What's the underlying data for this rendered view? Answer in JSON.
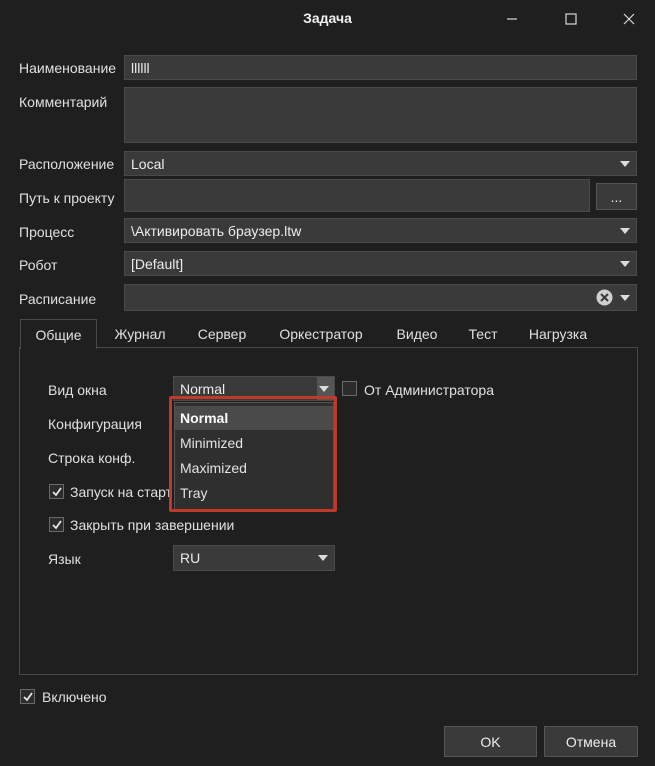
{
  "window": {
    "title": "Задача"
  },
  "form": {
    "name_label": "Наименование",
    "name_value": "llllll",
    "comment_label": "Комментарий",
    "comment_value": "",
    "location_label": "Расположение",
    "location_value": "Local",
    "project_path_label": "Путь к проекту",
    "project_path_value": "",
    "browse_label": "...",
    "process_label": "Процесс",
    "process_value": "\\Активировать браузер.ltw",
    "robot_label": "Робот",
    "robot_value": "[Default]",
    "schedule_label": "Расписание",
    "schedule_value": ""
  },
  "tabs": [
    {
      "label": "Общие",
      "active": true
    },
    {
      "label": "Журнал"
    },
    {
      "label": "Сервер"
    },
    {
      "label": "Оркестратор"
    },
    {
      "label": "Видео"
    },
    {
      "label": "Тест"
    },
    {
      "label": "Нагрузка"
    }
  ],
  "general": {
    "window_mode_label": "Вид окна",
    "window_mode_value": "Normal",
    "admin_label": "От Администратора",
    "admin_checked": false,
    "config_label": "Конфигурация",
    "config_string_label": "Строка конф.",
    "autostart_label": "Запуск на старте",
    "autostart_checked": true,
    "close_on_finish_label": "Закрыть при завершении",
    "close_on_finish_checked": true,
    "language_label": "Язык",
    "language_value": "RU"
  },
  "window_mode_options": [
    "Normal",
    "Minimized",
    "Maximized",
    "Tray"
  ],
  "enabled": {
    "label": "Включено",
    "checked": true
  },
  "buttons": {
    "ok": "OK",
    "cancel": "Отмена"
  },
  "colors": {
    "highlight": "#c0392b",
    "background": "#1f1f1f",
    "field": "#3a3a3a"
  }
}
